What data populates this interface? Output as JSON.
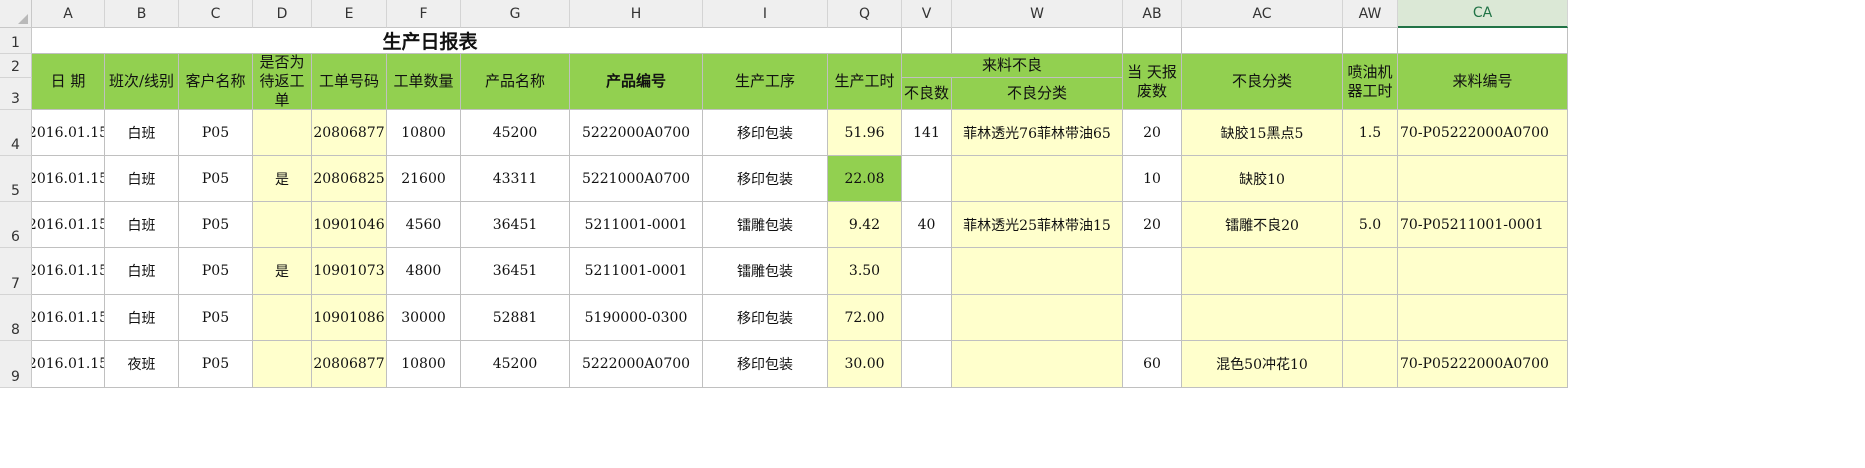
{
  "columns": [
    "A",
    "B",
    "C",
    "D",
    "E",
    "F",
    "G",
    "H",
    "I",
    "Q",
    "V",
    "W",
    "AB",
    "AC",
    "AW",
    "CA"
  ],
  "selected_column": "CA",
  "rows": [
    "1",
    "2",
    "3",
    "4",
    "5",
    "6",
    "7",
    "8",
    "9"
  ],
  "title": "生产日报表",
  "headers": {
    "date": "日 期",
    "shift": "班次/线别",
    "customer": "客户名称",
    "rework": "是否为待返工单",
    "order_no": "工单号码",
    "order_qty": "工单数量",
    "product_name": "产品名称",
    "product_code": "产品编号",
    "process": "生产工序",
    "hours": "生产工时",
    "incoming_defect": "来料不良",
    "defect_qty": "不良数",
    "defect_type": "不良分类",
    "scrap": "当 天报废数",
    "defect_class": "不良分类",
    "spray_hours": "喷油机器工时",
    "material_no": "来料编号"
  },
  "data": [
    {
      "date": "2016.01.15",
      "shift": "白班",
      "customer": "P05",
      "rework": "",
      "order_no": "20806877",
      "order_qty": "10800",
      "product_name": "45200",
      "product_code": "5222000A0700",
      "process": "移印包装",
      "hours": "51.96",
      "defect_qty": "141",
      "defect_type": "菲林透光76菲林带油65",
      "scrap": "20",
      "defect_class": "缺胶15黑点5",
      "spray_hours": "1.5",
      "material_no": "70-P05222000A0700"
    },
    {
      "date": "2016.01.15",
      "shift": "白班",
      "customer": "P05",
      "rework": "是",
      "order_no": "20806825",
      "order_qty": "21600",
      "product_name": "43311",
      "product_code": "5221000A0700",
      "process": "移印包装",
      "hours": "22.08",
      "defect_qty": "",
      "defect_type": "",
      "scrap": "10",
      "defect_class": "缺胶10",
      "spray_hours": "",
      "material_no": ""
    },
    {
      "date": "2016.01.15",
      "shift": "白班",
      "customer": "P05",
      "rework": "",
      "order_no": "10901046",
      "order_qty": "4560",
      "product_name": "36451",
      "product_code": "5211001-0001",
      "process": "镭雕包装",
      "hours": "9.42",
      "defect_qty": "40",
      "defect_type": "菲林透光25菲林带油15",
      "scrap": "20",
      "defect_class": "镭雕不良20",
      "spray_hours": "5.0",
      "material_no": "70-P05211001-0001"
    },
    {
      "date": "2016.01.15",
      "shift": "白班",
      "customer": "P05",
      "rework": "是",
      "order_no": "10901073",
      "order_qty": "4800",
      "product_name": "36451",
      "product_code": "5211001-0001",
      "process": "镭雕包装",
      "hours": "3.50",
      "defect_qty": "",
      "defect_type": "",
      "scrap": "",
      "defect_class": "",
      "spray_hours": "",
      "material_no": ""
    },
    {
      "date": "2016.01.15",
      "shift": "白班",
      "customer": "P05",
      "rework": "",
      "order_no": "10901086",
      "order_qty": "30000",
      "product_name": "52881",
      "product_code": "5190000-0300",
      "process": "移印包装",
      "hours": "72.00",
      "defect_qty": "",
      "defect_type": "",
      "scrap": "",
      "defect_class": "",
      "spray_hours": "",
      "material_no": ""
    },
    {
      "date": "2016.01.15",
      "shift": "夜班",
      "customer": "P05",
      "rework": "",
      "order_no": "20806877",
      "order_qty": "10800",
      "product_name": "45200",
      "product_code": "5222000A0700",
      "process": "移印包装",
      "hours": "30.00",
      "defect_qty": "",
      "defect_type": "",
      "scrap": "60",
      "defect_class": "混色50冲花10",
      "spray_hours": "",
      "material_no": "70-P05222000A0700"
    }
  ],
  "colors": {
    "header_green": "#92d050",
    "cell_yellow": "#ffffcc",
    "highlight_green": "#92d050",
    "selected_header": "#217346"
  }
}
